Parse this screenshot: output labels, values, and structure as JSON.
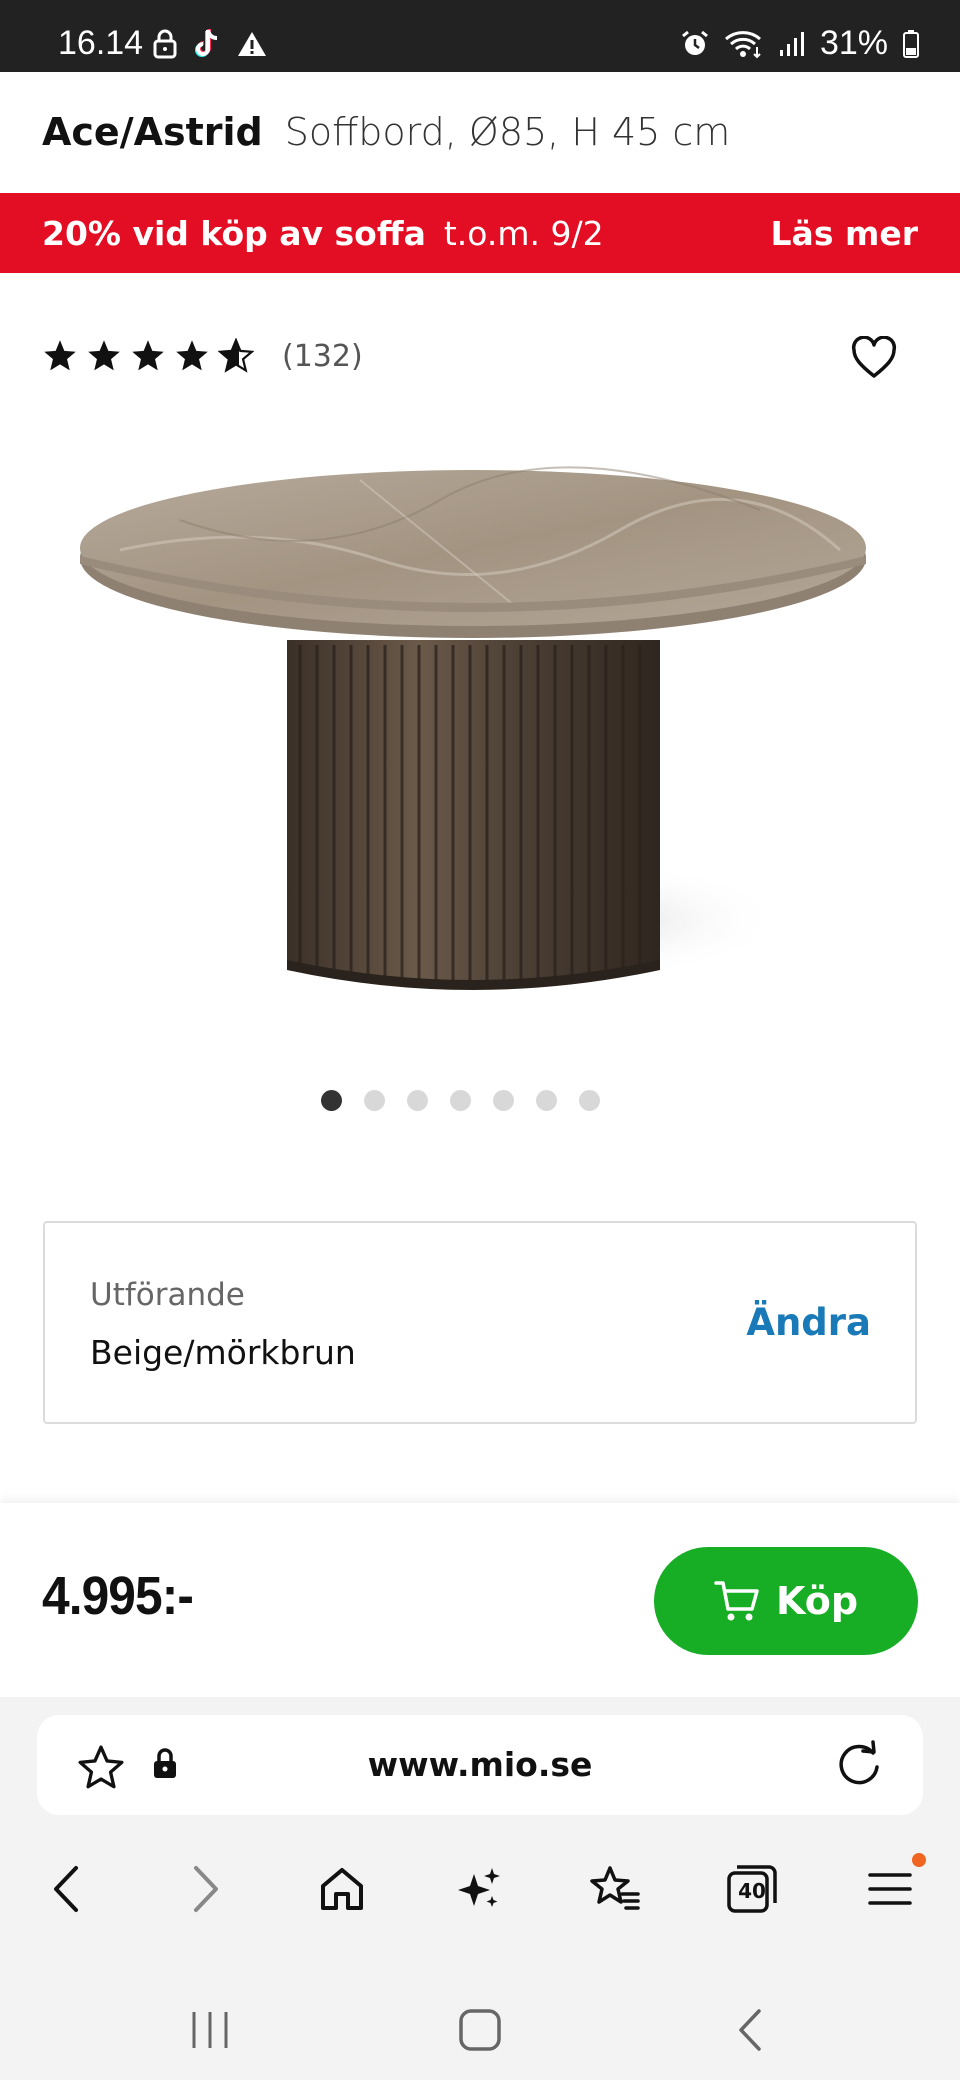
{
  "status_bar": {
    "time": "16.14",
    "battery": "31%",
    "left_icons": [
      "lock-icon",
      "tiktok-icon",
      "warning-icon"
    ],
    "right_icons": [
      "alarm-icon",
      "wifi-icon",
      "signal-icon",
      "battery-icon"
    ]
  },
  "product": {
    "brand": "Ace/Astrid",
    "name": "Soffbord, Ø85, H 45 cm",
    "rating": 4.5,
    "review_count": "(132)",
    "image_count": 7,
    "active_image": 1
  },
  "promo": {
    "text": "20% vid köp av soffa",
    "date": "t.o.m. 9/2",
    "link": "Läs mer",
    "color": "#e30e24"
  },
  "variant": {
    "label": "Utförande",
    "value": "Beige/mörkbrun",
    "change_label": "Ändra"
  },
  "purchase": {
    "price": "4.995:-",
    "buy_label": "Köp",
    "buy_color": "#17ad24"
  },
  "browser": {
    "url": "www.mio.se",
    "tab_count": "40",
    "nav_icons": [
      "back-icon",
      "forward-icon",
      "home-icon",
      "sparkle-icon",
      "bookmarks-icon",
      "tabs-icon",
      "menu-icon"
    ]
  }
}
